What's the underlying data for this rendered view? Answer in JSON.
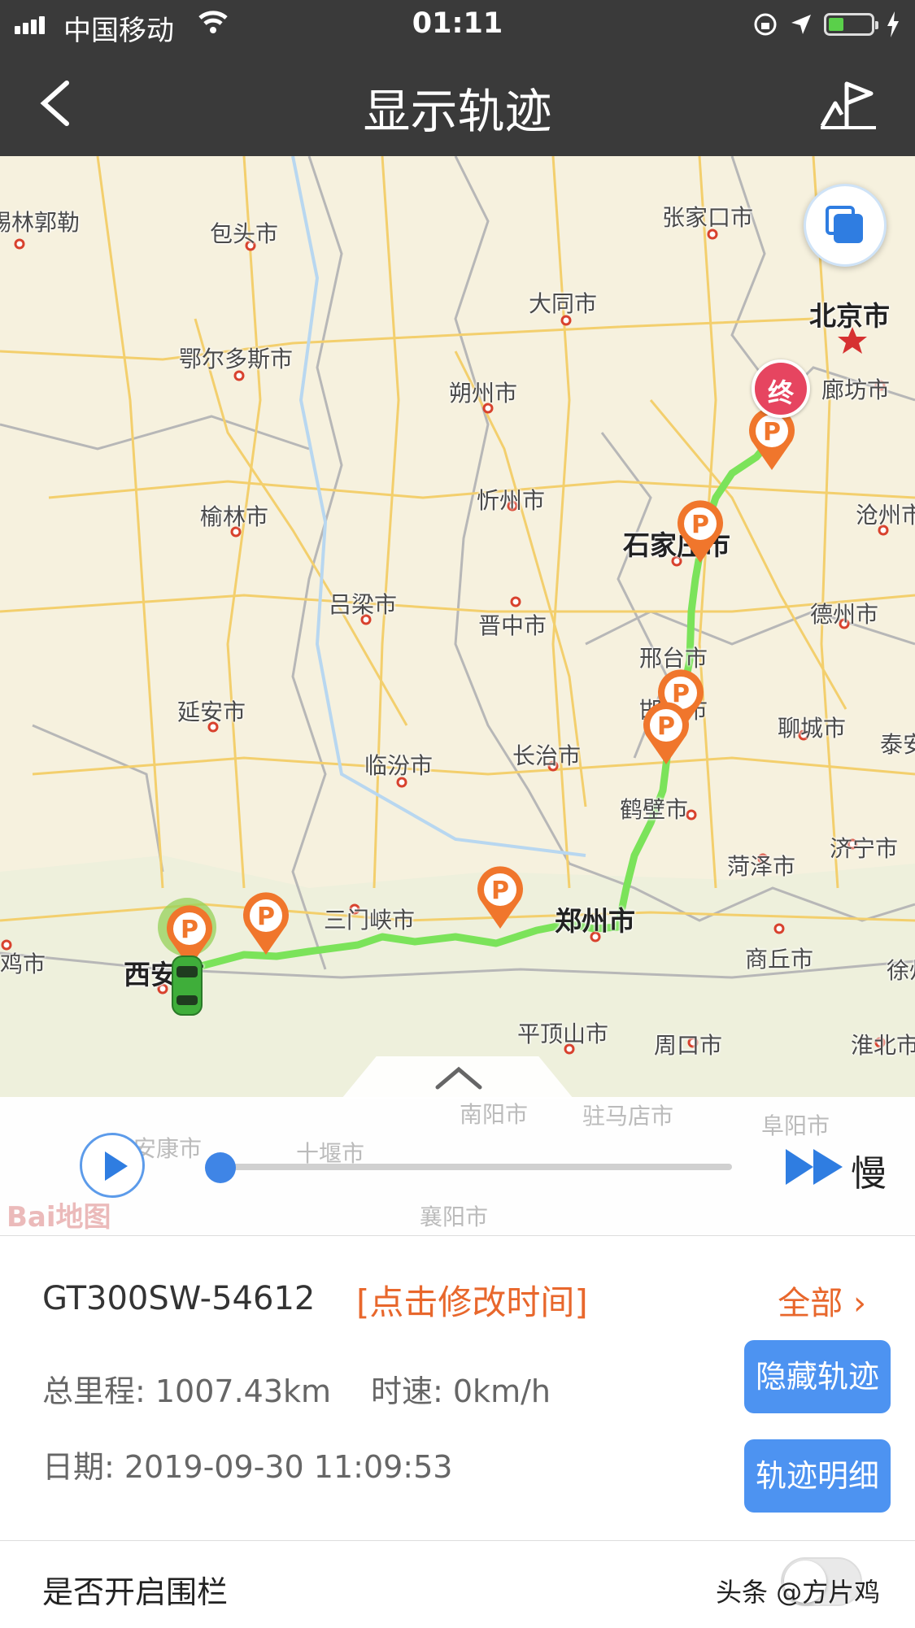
{
  "status_bar": {
    "carrier": "中国移动",
    "time": "01:11"
  },
  "nav": {
    "title": "显示轨迹"
  },
  "map": {
    "cities": [
      {
        "id": "xilinhaote",
        "name": "锡林郭勒"
      },
      {
        "id": "zhangjiakou",
        "name": "张家口市"
      },
      {
        "id": "baotou",
        "name": "包头市"
      },
      {
        "id": "datong",
        "name": "大同市"
      },
      {
        "id": "beijing",
        "name": "北京市"
      },
      {
        "id": "ordos",
        "name": "鄂尔多斯市"
      },
      {
        "id": "shuozhou",
        "name": "朔州市"
      },
      {
        "id": "langfang",
        "name": "廊坊市"
      },
      {
        "id": "xinzhou",
        "name": "忻州市"
      },
      {
        "id": "yulin",
        "name": "榆林市"
      },
      {
        "id": "cangzhou",
        "name": "沧州市"
      },
      {
        "id": "shijiazhuang",
        "name": "石家庄市"
      },
      {
        "id": "lvliang",
        "name": "吕梁市"
      },
      {
        "id": "jinzhong",
        "name": "晋中市"
      },
      {
        "id": "dezhou",
        "name": "德州市"
      },
      {
        "id": "xingtai",
        "name": "邢台市"
      },
      {
        "id": "handan",
        "name": "邯郸市"
      },
      {
        "id": "yanan",
        "name": "延安市"
      },
      {
        "id": "liaocheng",
        "name": "聊城市"
      },
      {
        "id": "taian",
        "name": "泰安"
      },
      {
        "id": "linfen",
        "name": "临汾市"
      },
      {
        "id": "changzhi",
        "name": "长治市"
      },
      {
        "id": "hebi",
        "name": "鹤壁市"
      },
      {
        "id": "jining",
        "name": "济宁市"
      },
      {
        "id": "heze",
        "name": "菏泽市"
      },
      {
        "id": "sanmenxia",
        "name": "三门峡市"
      },
      {
        "id": "zhengzhou",
        "name": "郑州市"
      },
      {
        "id": "baoji",
        "name": "宝鸡市"
      },
      {
        "id": "xian",
        "name": "西安市"
      },
      {
        "id": "shangqiu",
        "name": "商丘市"
      },
      {
        "id": "xuzhou",
        "name": "徐州"
      },
      {
        "id": "pingdingshan",
        "name": "平顶山市"
      },
      {
        "id": "zhoukou",
        "name": "周口市"
      },
      {
        "id": "huaibei",
        "name": "淮北市"
      },
      {
        "id": "nanyang",
        "name": "南阳市"
      },
      {
        "id": "zhumadian",
        "name": "驻马店市"
      },
      {
        "id": "ankang",
        "name": "安康市"
      },
      {
        "id": "shiyan",
        "name": "十堰市"
      },
      {
        "id": "fuyang",
        "name": "阜阳市"
      },
      {
        "id": "xiangyang",
        "name": "襄阳市"
      }
    ],
    "end_marker_label": "终",
    "parking_label": "P",
    "route_color": "#7be35a",
    "pin_color": "#f0762c"
  },
  "player": {
    "speed_label": "慢",
    "map_brand": "Bai地图",
    "progress": 0
  },
  "info": {
    "device": "GT300SW-54612",
    "edit_time": "[点击修改时间]",
    "all_label": "全部",
    "mileage": "总里程: 1007.43km",
    "speed": "时速: 0km/h",
    "date": "日期: 2019-09-30 11:09:53",
    "hide_track_button": "隐藏轨迹",
    "track_detail_button": "轨迹明细"
  },
  "fence": {
    "label": "是否开启围栏",
    "enabled": false
  },
  "watermark": "头条 @方片鸡"
}
